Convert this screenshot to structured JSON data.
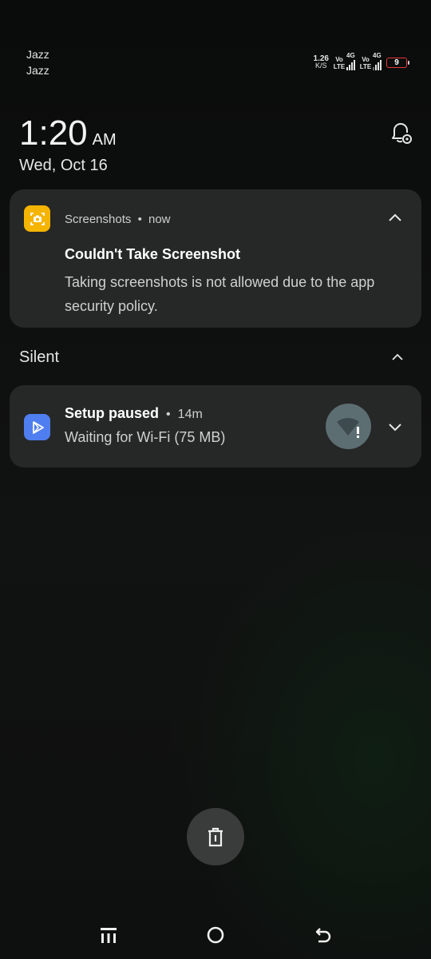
{
  "status_bar": {
    "carrier_1": "Jazz",
    "carrier_2": "Jazz",
    "net_speed_value": "1.26",
    "net_speed_unit": "K/S",
    "sim1_volte": "Vo LTE",
    "sim1_gen": "4G",
    "sim2_volte": "Vo LTE",
    "sim2_gen": "4G",
    "battery_level": "9",
    "battery_color": "#e23a3a"
  },
  "lockscreen": {
    "time": "1:20",
    "ampm": "AM",
    "date": "Wed, Oct 16",
    "notification_settings_icon": "bell-settings-icon"
  },
  "notifications": {
    "screenshot": {
      "app_name": "Screenshots",
      "separator": "•",
      "when": "now",
      "title": "Couldn't Take Screenshot",
      "body": "Taking screenshots is not allowed due to the app security policy.",
      "icon": "camera-icon",
      "icon_color": "#f5b400"
    },
    "silent_section_label": "Silent",
    "setup": {
      "title": "Setup paused",
      "separator": "•",
      "when": "14m",
      "body": "Waiting for Wi-Fi (75 MB)",
      "icon": "play-store-icon",
      "icon_color": "#4f7ef0",
      "status_icon": "wifi-alert-icon"
    }
  },
  "actions": {
    "clear_all_icon": "trash-icon"
  },
  "nav_bar": {
    "recents_icon": "menu-icon",
    "home_icon": "home-circle-icon",
    "back_icon": "back-icon"
  }
}
